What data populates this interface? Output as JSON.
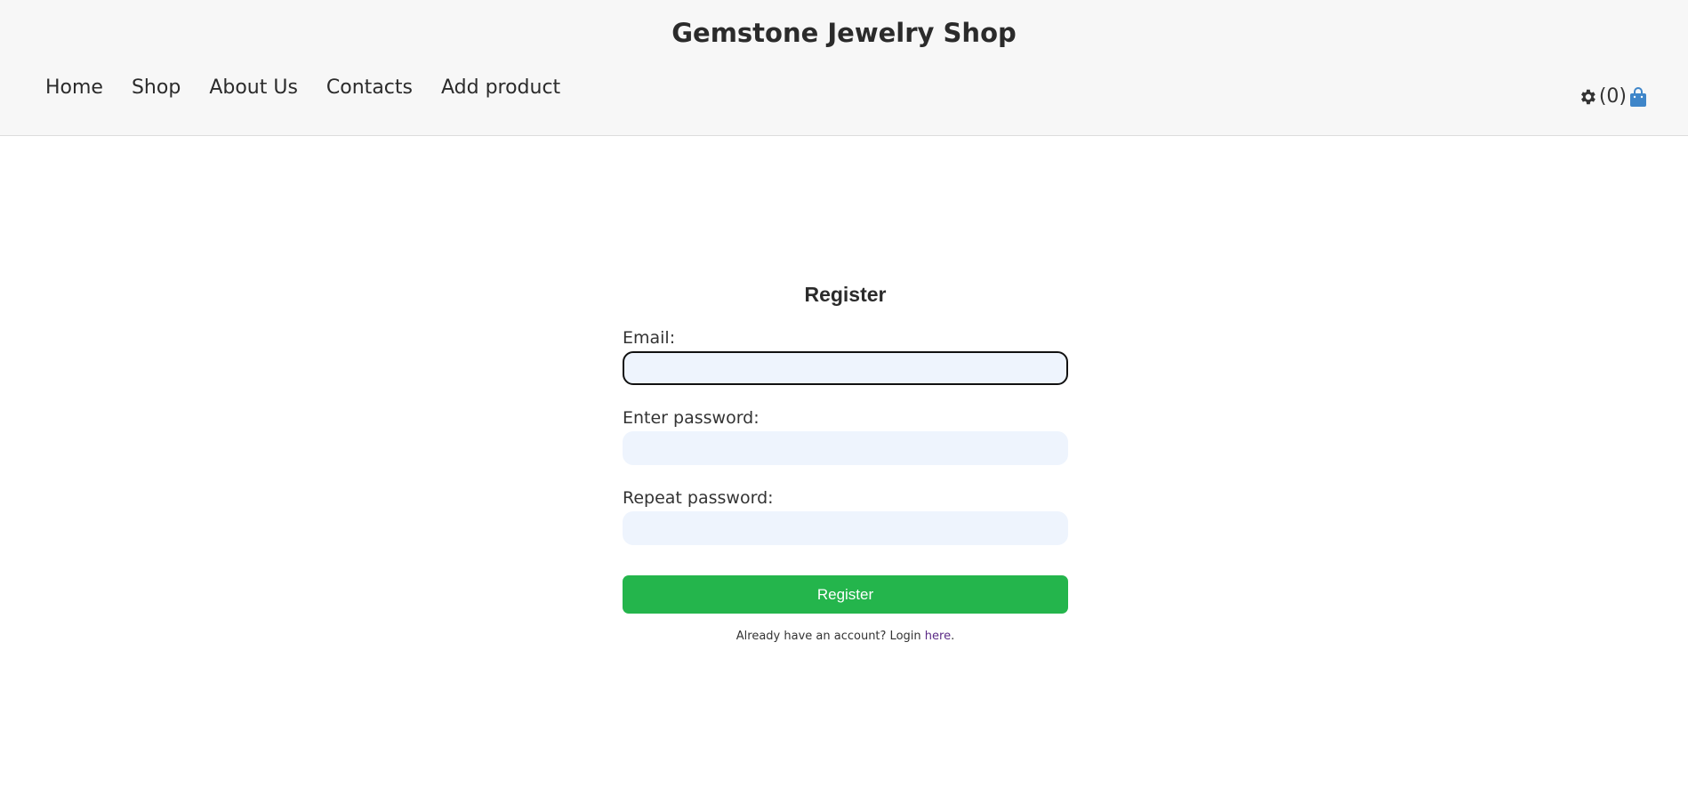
{
  "header": {
    "site_title": "Gemstone Jewelry Shop",
    "nav": [
      "Home",
      "Shop",
      "About Us",
      "Contacts",
      "Add product"
    ],
    "settings_icon": "gear-icon",
    "cart_count": "(0)",
    "cart_icon": "shopping-bag-icon",
    "cart_icon_color": "#3f86c9"
  },
  "form": {
    "title": "Register",
    "email_label": "Email:",
    "email_value": "",
    "password_label": "Enter password:",
    "password_value": "",
    "repeat_label": "Repeat password:",
    "repeat_value": "",
    "submit_label": "Register",
    "submit_color": "#24b54c",
    "login_prefix": "Already have an account? Login",
    "login_link": "here",
    "login_suffix": "."
  }
}
